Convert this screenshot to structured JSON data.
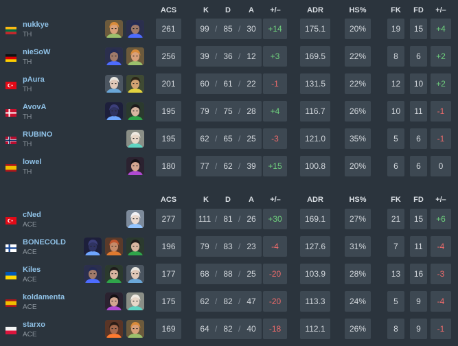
{
  "headers": {
    "acs": "ACS",
    "k": "K",
    "d": "D",
    "a": "A",
    "diff": "+/–",
    "adr": "ADR",
    "hs": "HS%",
    "fk": "FK",
    "fd": "FD",
    "fkdiff": "+/–"
  },
  "sep": "/",
  "teams": [
    {
      "players": [
        {
          "name": "nukkye",
          "team": "TH",
          "flag": "lithuania",
          "agents": [
            "skye",
            "yoru"
          ],
          "acs": "261",
          "k": "99",
          "d": "85",
          "a": "30",
          "diff": "+14",
          "adr": "175.1",
          "hs": "20%",
          "fk": "19",
          "fd": "15",
          "fkdiff": "+4"
        },
        {
          "name": "nieSoW",
          "team": "TH",
          "flag": "germany",
          "agents": [
            "yoru",
            "skye"
          ],
          "acs": "256",
          "k": "39",
          "d": "36",
          "a": "12",
          "diff": "+3",
          "adr": "169.5",
          "hs": "22%",
          "fk": "8",
          "fd": "6",
          "fkdiff": "+2"
        },
        {
          "name": "pAura",
          "team": "TH",
          "flag": "turkey",
          "agents": [
            "sova",
            "killjoy"
          ],
          "acs": "201",
          "k": "60",
          "d": "61",
          "a": "22",
          "diff": "-1",
          "adr": "131.5",
          "hs": "22%",
          "fk": "12",
          "fd": "10",
          "fkdiff": "+2"
        },
        {
          "name": "AvovA",
          "team": "TH",
          "flag": "denmark",
          "agents": [
            "omen",
            "viper"
          ],
          "acs": "195",
          "k": "79",
          "d": "75",
          "a": "28",
          "diff": "+4",
          "adr": "116.7",
          "hs": "26%",
          "fk": "10",
          "fd": "11",
          "fkdiff": "-1"
        },
        {
          "name": "RUBINO",
          "team": "TH",
          "flag": "norway",
          "agents": [
            "sage"
          ],
          "acs": "195",
          "k": "62",
          "d": "65",
          "a": "25",
          "diff": "-3",
          "adr": "121.0",
          "hs": "35%",
          "fk": "5",
          "fd": "6",
          "fkdiff": "-1"
        },
        {
          "name": "lowel",
          "team": "TH",
          "flag": "spain",
          "agents": [
            "reyna"
          ],
          "acs": "180",
          "k": "77",
          "d": "62",
          "a": "39",
          "diff": "+15",
          "adr": "100.8",
          "hs": "20%",
          "fk": "6",
          "fd": "6",
          "fkdiff": "0"
        }
      ]
    },
    {
      "players": [
        {
          "name": "cNed",
          "team": "ACE",
          "flag": "turkey",
          "agents": [
            "jett"
          ],
          "acs": "277",
          "k": "111",
          "d": "81",
          "a": "26",
          "diff": "+30",
          "adr": "169.1",
          "hs": "27%",
          "fk": "21",
          "fd": "15",
          "fkdiff": "+6"
        },
        {
          "name": "BONECOLD",
          "team": "ACE",
          "flag": "finland",
          "agents": [
            "omen",
            "breach",
            "viper"
          ],
          "acs": "196",
          "k": "79",
          "d": "83",
          "a": "23",
          "diff": "-4",
          "adr": "127.6",
          "hs": "31%",
          "fk": "7",
          "fd": "11",
          "fkdiff": "-4"
        },
        {
          "name": "Kiles",
          "team": "ACE",
          "flag": "ukraine",
          "agents": [
            "yoru",
            "viper",
            "sova"
          ],
          "acs": "177",
          "k": "68",
          "d": "88",
          "a": "25",
          "diff": "-20",
          "adr": "103.9",
          "hs": "28%",
          "fk": "13",
          "fd": "16",
          "fkdiff": "-3"
        },
        {
          "name": "koldamenta",
          "team": "ACE",
          "flag": "spain",
          "agents": [
            "reyna",
            "sage"
          ],
          "acs": "175",
          "k": "62",
          "d": "82",
          "a": "47",
          "diff": "-20",
          "adr": "113.3",
          "hs": "24%",
          "fk": "5",
          "fd": "9",
          "fkdiff": "-4"
        },
        {
          "name": "starxo",
          "team": "ACE",
          "flag": "poland",
          "agents": [
            "phoenix",
            "skye"
          ],
          "acs": "169",
          "k": "64",
          "d": "82",
          "a": "40",
          "diff": "-18",
          "adr": "112.1",
          "hs": "26%",
          "fk": "8",
          "fd": "9",
          "fkdiff": "-1"
        }
      ]
    }
  ],
  "colors": {
    "positive": "#6fd17d",
    "negative": "#ef6b6b",
    "player_name": "#8fc1e6",
    "cell_bg": "#3d4852",
    "page_bg": "#2b343d"
  }
}
